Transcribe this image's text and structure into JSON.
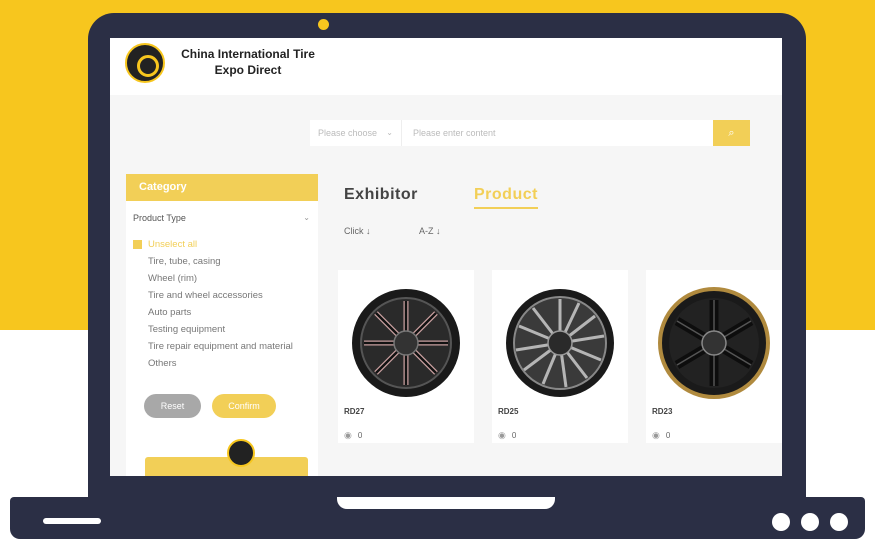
{
  "header": {
    "site_title": "China International Tire Expo Direct"
  },
  "search": {
    "select_placeholder": "Please choose",
    "input_placeholder": "Please enter content"
  },
  "sidebar": {
    "category_title": "Category",
    "product_type_label": "Product Type",
    "items": [
      {
        "label": "Unselect all",
        "active": true
      },
      {
        "label": "Tire,  tube,  casing",
        "active": false
      },
      {
        "label": "Wheel (rim)",
        "active": false
      },
      {
        "label": "Tire and wheel accessories",
        "active": false
      },
      {
        "label": "Auto parts",
        "active": false
      },
      {
        "label": "Testing equipment",
        "active": false
      },
      {
        "label": "Tire repair equipment and material",
        "active": false
      },
      {
        "label": "Others",
        "active": false
      }
    ],
    "reset_label": "Reset",
    "confirm_label": "Confirm"
  },
  "tabs": {
    "exhibitor": "Exhibitor",
    "product": "Product"
  },
  "sort": {
    "click": "Click ↓",
    "az": "A-Z ↓"
  },
  "products": [
    {
      "name": "RD27",
      "views": "0"
    },
    {
      "name": "RD25",
      "views": "0"
    },
    {
      "name": "RD23",
      "views": "0"
    }
  ],
  "colors": {
    "background_yellow": "#f7c61e",
    "laptop_body": "#2b2f45",
    "accent": "#f2cf57",
    "reset_gray": "#a8a8a8"
  }
}
